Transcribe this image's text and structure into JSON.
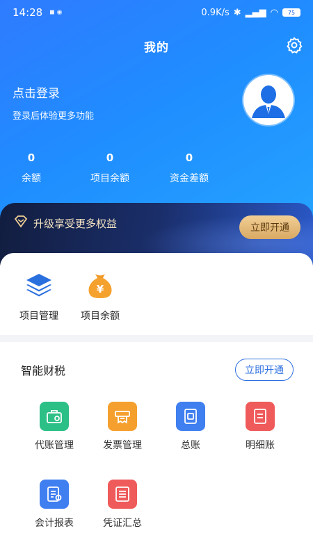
{
  "status": {
    "time": "14:28",
    "network_speed": "0.9K/s",
    "battery": "75"
  },
  "header": {
    "title": "我的"
  },
  "login": {
    "title": "点击登录",
    "subtitle": "登录后体验更多功能"
  },
  "stats": [
    {
      "value": "0",
      "label": "余额"
    },
    {
      "value": "0",
      "label": "项目余额"
    },
    {
      "value": "0",
      "label": "资金差额"
    }
  ],
  "vip": {
    "text": "升级享受更多权益",
    "button": "立即开通"
  },
  "quick": [
    {
      "label": "项目管理",
      "icon": "layers-icon"
    },
    {
      "label": "项目余额",
      "icon": "money-bag-icon"
    }
  ],
  "smart_tax": {
    "title": "智能财税",
    "button": "立即开通",
    "items": [
      {
        "label": "代账管理",
        "icon": "briefcase-icon",
        "color": "#2cbf86"
      },
      {
        "label": "发票管理",
        "icon": "invoice-printer-icon",
        "color": "#f5a02e"
      },
      {
        "label": "总账",
        "icon": "ledger-icon",
        "color": "#3f7ff0"
      },
      {
        "label": "明细账",
        "icon": "document-icon",
        "color": "#ef5a5a"
      },
      {
        "label": "会计报表",
        "icon": "report-icon",
        "color": "#3f7ff0"
      },
      {
        "label": "凭证汇总",
        "icon": "list-icon",
        "color": "#ef5a5a"
      }
    ]
  }
}
